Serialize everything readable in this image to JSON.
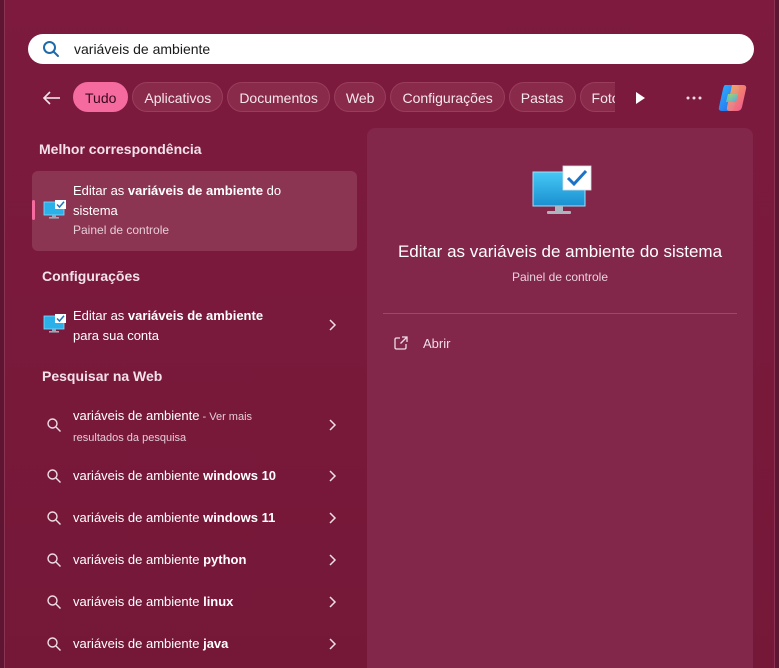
{
  "search": {
    "value": "variáveis de ambiente"
  },
  "filters": [
    {
      "label": "Tudo",
      "active": true
    },
    {
      "label": "Aplicativos"
    },
    {
      "label": "Documentos"
    },
    {
      "label": "Web"
    },
    {
      "label": "Configurações"
    },
    {
      "label": "Pastas"
    },
    {
      "label": "Fotos"
    }
  ],
  "sections": {
    "best_match": "Melhor correspondência",
    "settings": "Configurações",
    "web": "Pesquisar na Web"
  },
  "best_match": {
    "prefix": "Editar as ",
    "bold": "variáveis de ambiente",
    "suffix": " do",
    "line2": "sistema",
    "subtitle": "Painel de controle"
  },
  "settings_item": {
    "prefix": "Editar as ",
    "bold": "variáveis de ambiente",
    "line2": "para sua conta"
  },
  "web_results": [
    {
      "base": "variáveis de ambiente",
      "bold": "",
      "extra": " - Ver mais",
      "line2": "resultados da pesquisa"
    },
    {
      "base": "variáveis de ambiente ",
      "bold": "windows 10"
    },
    {
      "base": "variáveis de ambiente ",
      "bold": "windows 11"
    },
    {
      "base": "variáveis de ambiente ",
      "bold": "python"
    },
    {
      "base": "variáveis de ambiente ",
      "bold": "linux"
    },
    {
      "base": "variáveis de ambiente ",
      "bold": "java"
    }
  ],
  "preview": {
    "title": "Editar as variáveis de ambiente do sistema",
    "subtitle": "Painel de controle",
    "open_label": "Abrir"
  },
  "icons": {
    "search": "search-icon",
    "back": "back-arrow-icon",
    "play": "play-icon",
    "more": "more-icon",
    "copilot": "copilot-icon",
    "monitor": "monitor-check-icon",
    "chevron": "chevron-right-icon",
    "open": "open-external-icon"
  },
  "colors": {
    "accent": "#f56a9f",
    "panel": "#7d1a3e",
    "preview": "#82264a"
  }
}
